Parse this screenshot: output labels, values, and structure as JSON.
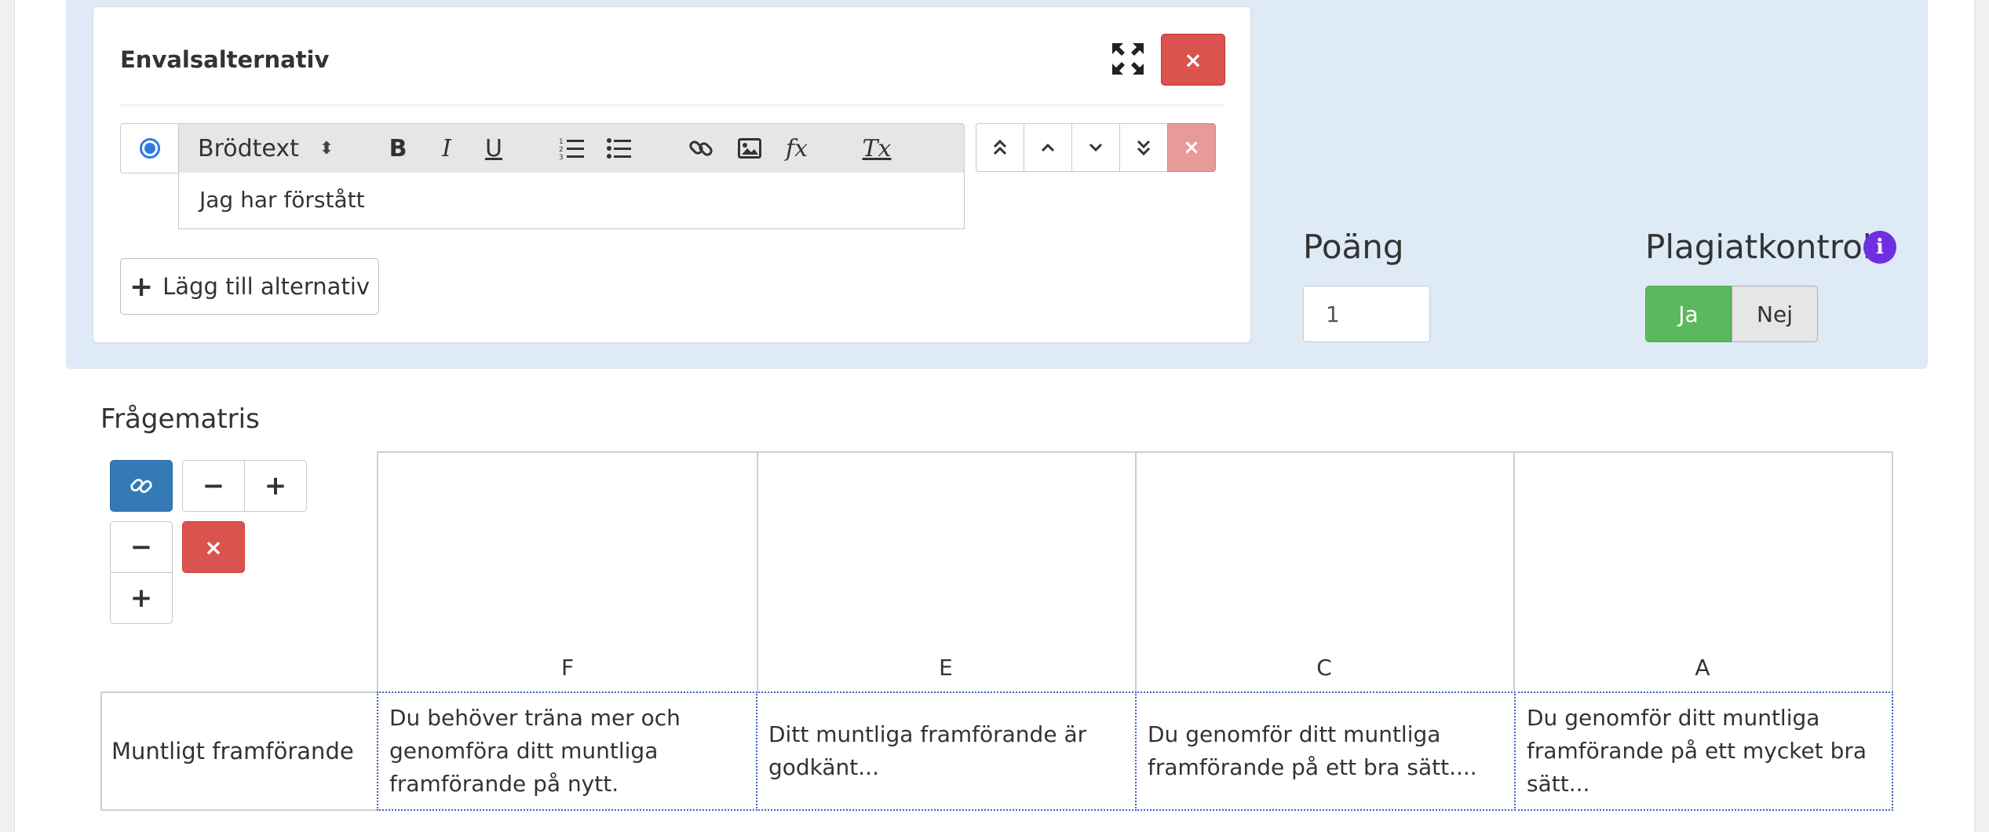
{
  "card": {
    "title": "Envalsalternativ",
    "expand_icon": "expand-arrows-icon",
    "close_label": "×"
  },
  "editor": {
    "format_label": "Brödtext",
    "format_caret": "⬍",
    "toolbar_icons": [
      "bold-icon",
      "italic-icon",
      "underline-icon",
      "ordered-list-icon",
      "unordered-list-icon",
      "link-icon",
      "image-icon",
      "formula-icon",
      "clear-format-icon"
    ],
    "bold": "B",
    "italic": "I",
    "underline": "U",
    "formula": "fx",
    "clear": "Tx",
    "content": "Jag har förstått"
  },
  "move_buttons": {
    "top": "⏫",
    "up": "⌃",
    "down": "⌄",
    "bottom": "⏬",
    "delete": "×"
  },
  "add_alternative_label": "Lägg till alternativ",
  "points": {
    "label": "Poäng",
    "value": "1"
  },
  "plagiarism": {
    "label": "Plagiatkontroll",
    "info": "i",
    "yes": "Ja",
    "no": "Nej",
    "selected": "Ja",
    "yes_color": "#5cb85c"
  },
  "matrix": {
    "label": "Frågematris",
    "buttons": {
      "link_icon": "link-icon",
      "minus": "−",
      "plus": "+",
      "remove": "×"
    },
    "columns": [
      "F",
      "E",
      "C",
      "A"
    ],
    "rows": [
      {
        "label": "Muntligt framförande",
        "cells": [
          "Du behöver träna mer och genomföra ditt muntliga framförande på nytt.",
          "Ditt muntliga framförande är godkänt...",
          "Du genomför ditt muntliga framförande på ett bra sätt....",
          "Du genomför ditt muntliga framförande på ett mycket bra sätt..."
        ]
      }
    ]
  },
  "colors": {
    "panel_bg": "#deeaf6",
    "danger": "#d9534f",
    "primary": "#337ab7",
    "info": "#6f2fe0",
    "radio": "#2e7be6"
  }
}
